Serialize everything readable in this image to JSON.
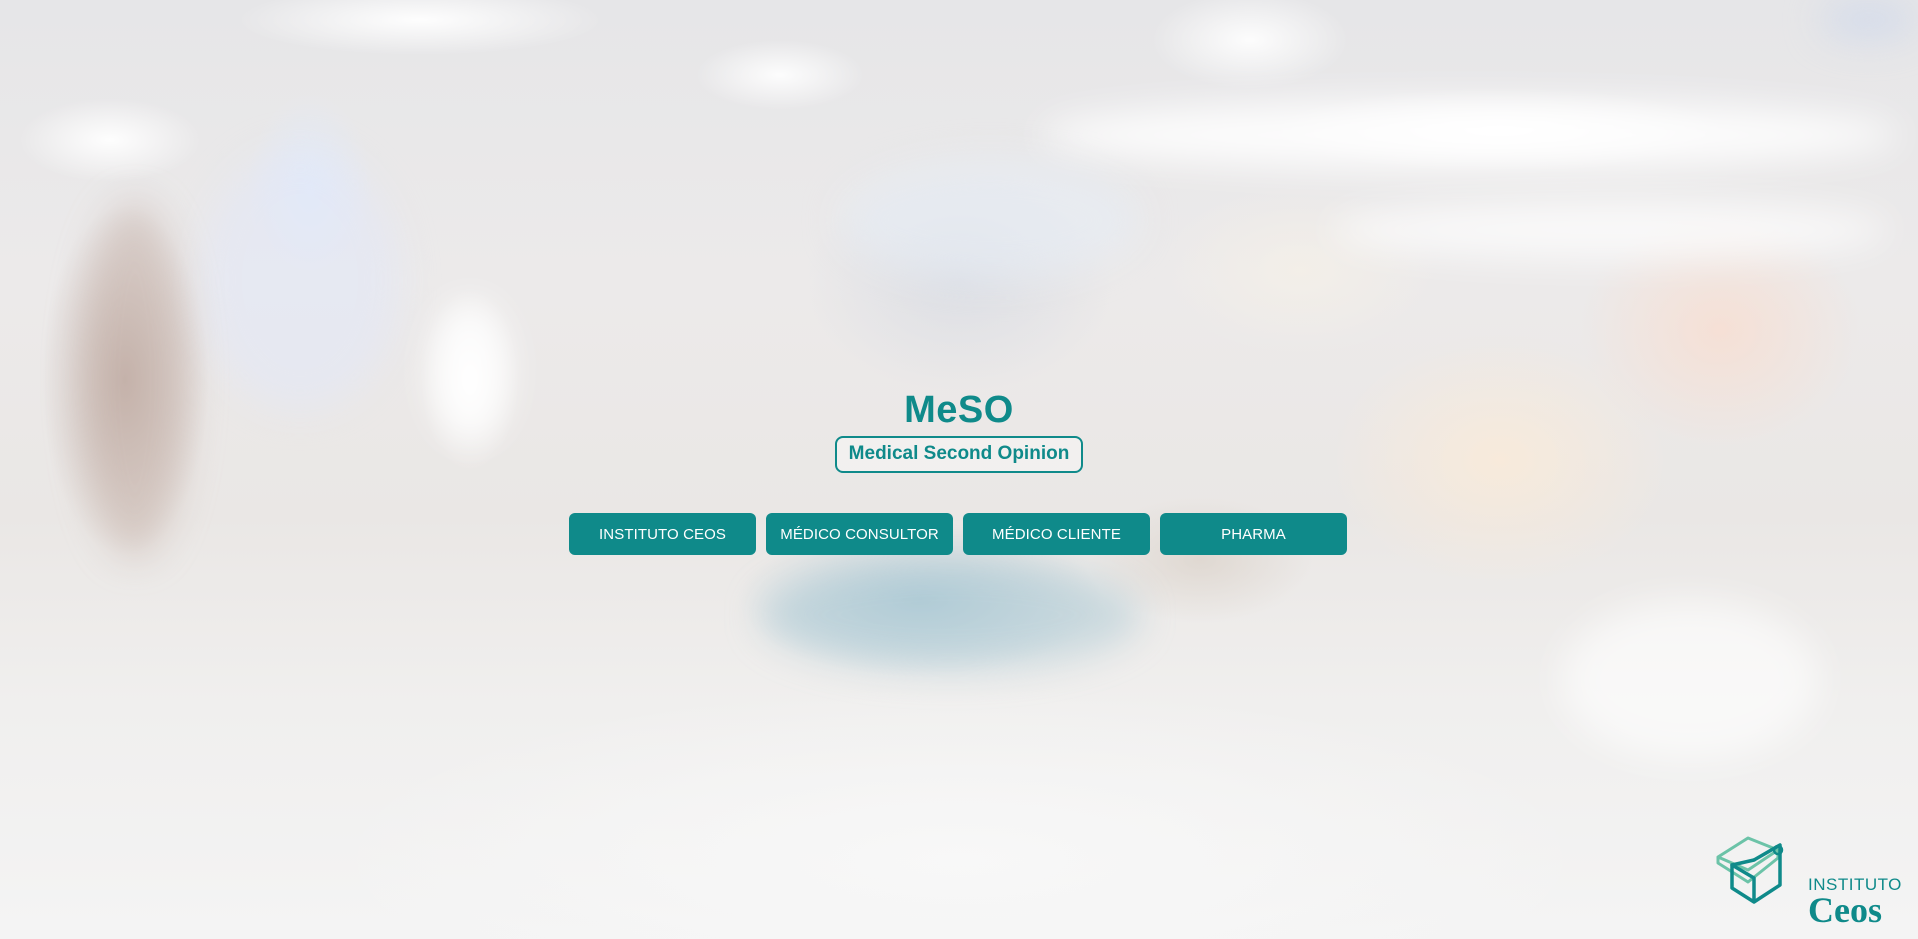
{
  "app": {
    "title": "MeSO",
    "subtitle": "Medical Second Opinion"
  },
  "nav": {
    "buttons": [
      {
        "label": "INSTITUTO CEOS"
      },
      {
        "label": "MÉDICO CONSULTOR"
      },
      {
        "label": "MÉDICO CLIENTE"
      },
      {
        "label": "PHARMA"
      }
    ]
  },
  "logo": {
    "line1": "INSTITUTO",
    "line2": "Ceos",
    "icon": "cube-logo-icon"
  },
  "colors": {
    "accent": "#0f8a8a",
    "button_text": "#ffffff",
    "logo_light": "#6cc3a8"
  }
}
